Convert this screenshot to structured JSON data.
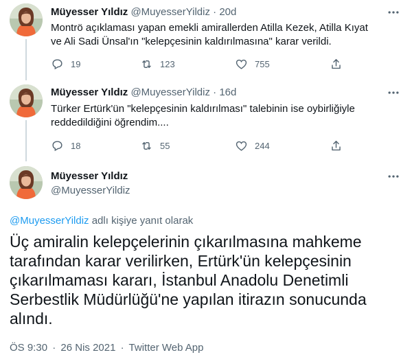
{
  "thread": {
    "tweets": [
      {
        "author_name": "Müyesser Yıldız",
        "handle": "@MuyesserYildiz",
        "separator": "·",
        "time": "20d",
        "text": "Montrö açıklaması yapan emekli amirallerden Atilla Kezek, Atilla Kıyat ve Ali Sadi Ünsal'ın \"kelepçesinin kaldırılmasına\" karar verildi.",
        "replies": "19",
        "retweets": "123",
        "likes": "755"
      },
      {
        "author_name": "Müyesser Yıldız",
        "handle": "@MuyesserYildiz",
        "separator": "·",
        "time": "16d",
        "text": "Türker Ertürk'ün \"kelepçesinin kaldırılması\" talebinin ise oybirliğiyle reddedildiğini öğrendim....",
        "replies": "18",
        "retweets": "55",
        "likes": "244"
      }
    ]
  },
  "main_tweet": {
    "author_name": "Müyesser Yıldız",
    "handle": "@MuyesserYildiz",
    "reply_to_mention": "@MuyesserYildiz",
    "reply_to_suffix": "adlı kişiye yanıt olarak",
    "text": "Üç amiralin kelepçelerinin çıkarılmasına mahkeme tarafından karar verilirken, Ertürk'ün kelepçesinin çıkarılmaması kararı, İstanbul Anadolu Denetimli Serbestlik Müdürlüğü'ne yapılan itirazın sonucunda alındı.",
    "time": "ÖS 9:30",
    "date": "26 Nis 2021",
    "source": "Twitter Web App",
    "meta_separator": "·"
  },
  "icons": {
    "reply": "reply-icon",
    "retweet": "retweet-icon",
    "like": "heart-icon",
    "share": "share-icon",
    "more": "more-icon"
  },
  "colors": {
    "text": "#0f1419",
    "secondary": "#536471",
    "link": "#1d9bf0",
    "thread_line": "#cfd9de"
  }
}
